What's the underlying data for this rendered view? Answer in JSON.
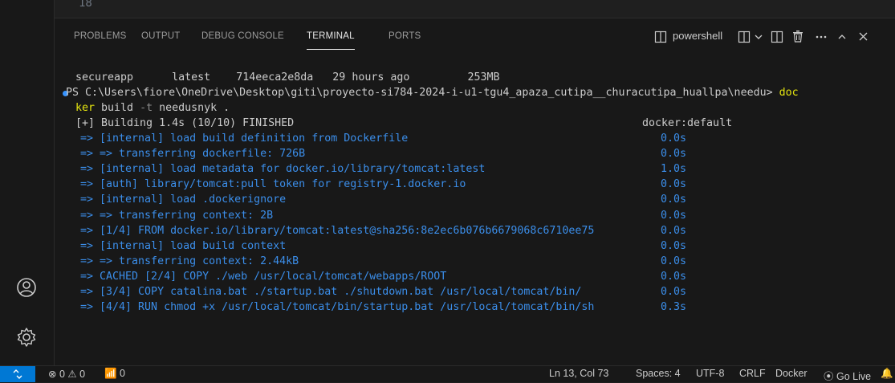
{
  "editor": {
    "line_number": "18"
  },
  "panel": {
    "tabs": [
      {
        "label": "PROBLEMS"
      },
      {
        "label": "OUTPUT"
      },
      {
        "label": "DEBUG CONSOLE"
      },
      {
        "label": "TERMINAL",
        "active": true
      },
      {
        "label": "PORTS"
      }
    ],
    "shell_name": "powershell"
  },
  "terminal": {
    "image_row": {
      "repository": "secureapp",
      "tag": "latest",
      "image_id": "714eeca2e8da",
      "created": "29 hours ago",
      "size": "253MB"
    },
    "prompt_line": "PS C:\\Users\\fiore\\OneDrive\\Desktop\\giti\\proyecto-si784-2024-i-u1-tgu4_apaza_cutipa__churacutipa_huallpa\\needu> ",
    "cmd_part1": "doc",
    "cmd_part2": "ker",
    "cmd_rest_a": " build ",
    "cmd_flag": "-t",
    "cmd_rest_b": " needusnyk .",
    "build_header": "[+] Building 1.4s (10/10) FINISHED",
    "build_context": "docker:default",
    "steps": [
      {
        "text": "=> [internal] load build definition from Dockerfile",
        "time": "0.0s",
        "blue": true
      },
      {
        "text": "=> => transferring dockerfile: 726B",
        "time": "0.0s",
        "blue": true
      },
      {
        "text": "=> [internal] load metadata for docker.io/library/tomcat:latest",
        "time": "1.0s",
        "blue": true
      },
      {
        "text": "=> [auth] library/tomcat:pull token for registry-1.docker.io",
        "time": "0.0s",
        "blue": true
      },
      {
        "text": "=> [internal] load .dockerignore",
        "time": "0.0s",
        "blue": true
      },
      {
        "text": "=> => transferring context: 2B",
        "time": "0.0s",
        "blue": true
      },
      {
        "text": "=> [1/4] FROM docker.io/library/tomcat:latest@sha256:8e2ec6b076b6679068c6710ee75",
        "time": "0.0s",
        "blue": true
      },
      {
        "text": "=> [internal] load build context",
        "time": "0.0s",
        "blue": true
      },
      {
        "text": "=> => transferring context: 2.44kB",
        "time": "0.0s",
        "blue": true
      },
      {
        "text": "=> CACHED [2/4] COPY ./web /usr/local/tomcat/webapps/ROOT",
        "time": "0.0s",
        "blue": true
      },
      {
        "text": "=> [3/4] COPY catalina.bat ./startup.bat ./shutdown.bat /usr/local/tomcat/bin/",
        "time": "0.0s",
        "blue": true
      },
      {
        "text": "=> [4/4] RUN chmod +x /usr/local/tomcat/bin/startup.bat /usr/local/tomcat/bin/sh",
        "time": "0.3s",
        "blue": true
      }
    ]
  },
  "statusbar": {
    "errors": "0",
    "warnings": "0",
    "ports": "0",
    "position": "Ln 13, Col 73",
    "spaces": "Spaces: 4",
    "encoding": "UTF-8",
    "eol": "CRLF",
    "language": "Docker",
    "golive": "Go Live"
  },
  "colors": {
    "accent": "#0078d4",
    "terminal_blue": "#3b8eea",
    "terminal_yellow": "#e5e510"
  }
}
